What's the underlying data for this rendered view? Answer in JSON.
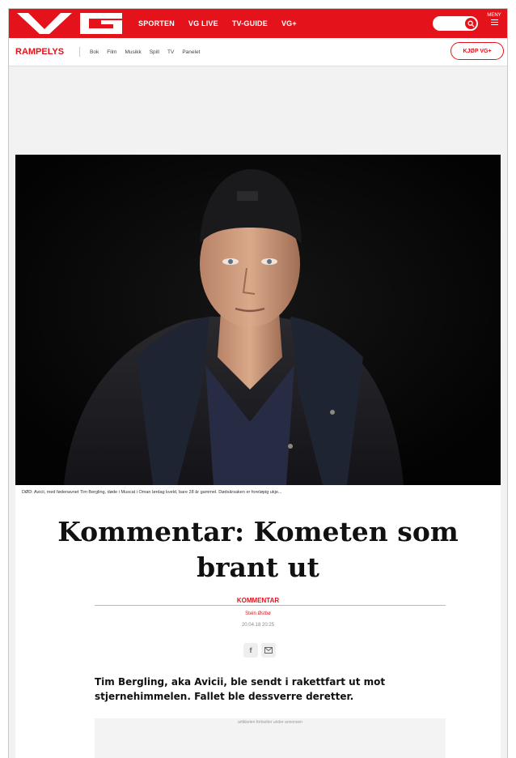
{
  "topbar": {
    "logo": "VG",
    "nav": [
      "SPORTEN",
      "VG LIVE",
      "TV-GUIDE",
      "VG+"
    ],
    "menu_label": "MENY",
    "brand_color": "#e4131b"
  },
  "subnav": {
    "section": "RAMPELYS",
    "items": [
      "Bok",
      "Film",
      "Musikk",
      "Spill",
      "TV",
      "Panelet"
    ],
    "buy_label": "KJØP VG+"
  },
  "article": {
    "image_alt": "Portrait of Avicii (Tim Bergling) in a black beanie and dark jacket against a black background",
    "caption": "DØD: Avicii, med fødenavnet Tim Bergling, døde i Muscat i Oman lørdag kveld, bare 28 år gammel. Dødsårsaken er foreløpig ukje...",
    "title": "Kommentar: Kometen som brant ut",
    "kicker": "KOMMENTAR",
    "author": "Stein Østbø",
    "date": "20.04.18 20:25",
    "lead": "Tim Bergling, aka Avicii, ble sendt i rakettfart ut mot stjernehimmelen. Fallet ble dessverre deretter.",
    "ad_label": "artikkelen fortsetter under annonsen"
  }
}
